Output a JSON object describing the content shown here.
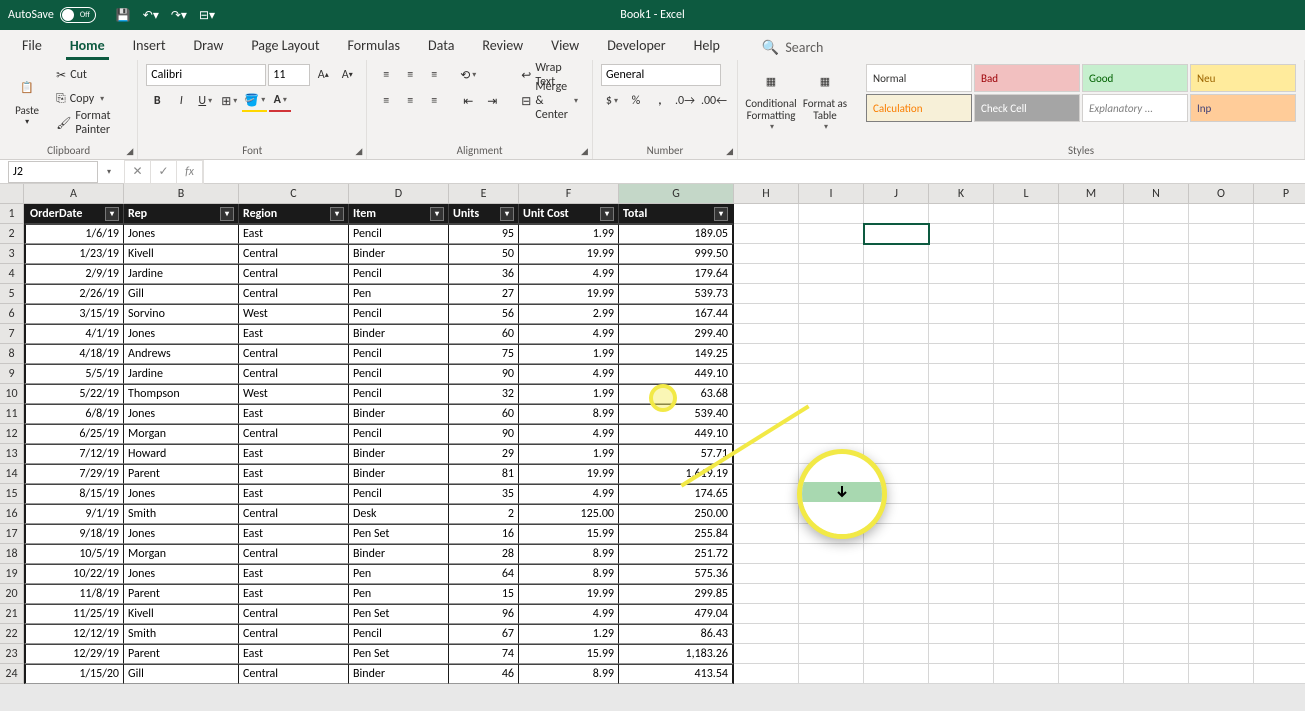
{
  "titlebar": {
    "autosave": "AutoSave",
    "toggle": "Off",
    "doctitle": "Book1 - Excel"
  },
  "tabs": [
    "File",
    "Home",
    "Insert",
    "Draw",
    "Page Layout",
    "Formulas",
    "Data",
    "Review",
    "View",
    "Developer",
    "Help"
  ],
  "search": "Search",
  "clipboard": {
    "paste": "Paste",
    "cut": "Cut",
    "copy": "Copy",
    "painter": "Format Painter",
    "label": "Clipboard"
  },
  "font": {
    "name": "Calibri",
    "size": "11",
    "label": "Font"
  },
  "alignment": {
    "wrap": "Wrap Text",
    "merge": "Merge & Center",
    "label": "Alignment"
  },
  "number": {
    "fmt": "General",
    "label": "Number"
  },
  "cond": {
    "cf": "Conditional Formatting",
    "fat": "Format as Table"
  },
  "styles": {
    "normal": "Normal",
    "bad": "Bad",
    "good": "Good",
    "neu": "Neu",
    "calc": "Calculation",
    "check": "Check Cell",
    "expl": "Explanatory ...",
    "inp": "Inp",
    "label": "Styles"
  },
  "namebox": "J2",
  "columns": [
    "A",
    "B",
    "C",
    "D",
    "E",
    "F",
    "G",
    "H",
    "I",
    "J",
    "K",
    "L",
    "M",
    "N",
    "O",
    "P"
  ],
  "headers": [
    "OrderDate",
    "Rep",
    "Region",
    "Item",
    "Units",
    "Unit Cost",
    "Total"
  ],
  "rows": [
    [
      "1/6/19",
      "Jones",
      "East",
      "Pencil",
      "95",
      "1.99",
      "189.05"
    ],
    [
      "1/23/19",
      "Kivell",
      "Central",
      "Binder",
      "50",
      "19.99",
      "999.50"
    ],
    [
      "2/9/19",
      "Jardine",
      "Central",
      "Pencil",
      "36",
      "4.99",
      "179.64"
    ],
    [
      "2/26/19",
      "Gill",
      "Central",
      "Pen",
      "27",
      "19.99",
      "539.73"
    ],
    [
      "3/15/19",
      "Sorvino",
      "West",
      "Pencil",
      "56",
      "2.99",
      "167.44"
    ],
    [
      "4/1/19",
      "Jones",
      "East",
      "Binder",
      "60",
      "4.99",
      "299.40"
    ],
    [
      "4/18/19",
      "Andrews",
      "Central",
      "Pencil",
      "75",
      "1.99",
      "149.25"
    ],
    [
      "5/5/19",
      "Jardine",
      "Central",
      "Pencil",
      "90",
      "4.99",
      "449.10"
    ],
    [
      "5/22/19",
      "Thompson",
      "West",
      "Pencil",
      "32",
      "1.99",
      "63.68"
    ],
    [
      "6/8/19",
      "Jones",
      "East",
      "Binder",
      "60",
      "8.99",
      "539.40"
    ],
    [
      "6/25/19",
      "Morgan",
      "Central",
      "Pencil",
      "90",
      "4.99",
      "449.10"
    ],
    [
      "7/12/19",
      "Howard",
      "East",
      "Binder",
      "29",
      "1.99",
      "57.71"
    ],
    [
      "7/29/19",
      "Parent",
      "East",
      "Binder",
      "81",
      "19.99",
      "1,619.19"
    ],
    [
      "8/15/19",
      "Jones",
      "East",
      "Pencil",
      "35",
      "4.99",
      "174.65"
    ],
    [
      "9/1/19",
      "Smith",
      "Central",
      "Desk",
      "2",
      "125.00",
      "250.00"
    ],
    [
      "9/18/19",
      "Jones",
      "East",
      "Pen Set",
      "16",
      "15.99",
      "255.84"
    ],
    [
      "10/5/19",
      "Morgan",
      "Central",
      "Binder",
      "28",
      "8.99",
      "251.72"
    ],
    [
      "10/22/19",
      "Jones",
      "East",
      "Pen",
      "64",
      "8.99",
      "575.36"
    ],
    [
      "11/8/19",
      "Parent",
      "East",
      "Pen",
      "15",
      "19.99",
      "299.85"
    ],
    [
      "11/25/19",
      "Kivell",
      "Central",
      "Pen Set",
      "96",
      "4.99",
      "479.04"
    ],
    [
      "12/12/19",
      "Smith",
      "Central",
      "Pencil",
      "67",
      "1.29",
      "86.43"
    ],
    [
      "12/29/19",
      "Parent",
      "East",
      "Pen Set",
      "74",
      "15.99",
      "1,183.26"
    ],
    [
      "1/15/20",
      "Gill",
      "Central",
      "Binder",
      "46",
      "8.99",
      "413.54"
    ]
  ]
}
